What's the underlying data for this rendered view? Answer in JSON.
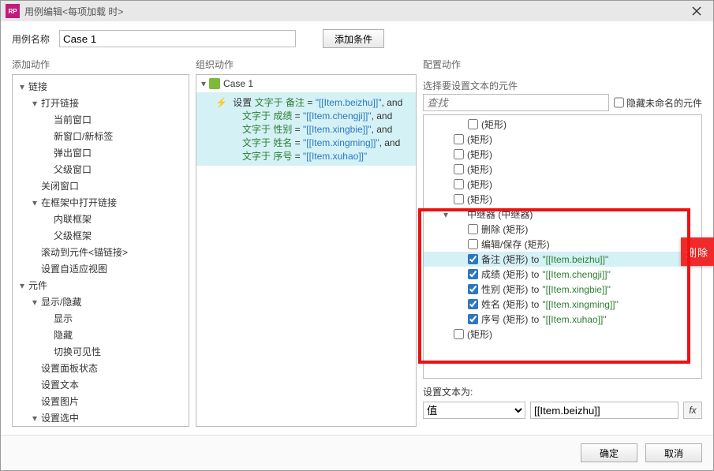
{
  "window": {
    "app_icon": "RP",
    "title": "用例编辑<每项加载 时>"
  },
  "name_row": {
    "label": "用例名称",
    "value": "Case 1",
    "add_condition": "添加条件"
  },
  "columns": {
    "left_header": "添加动作",
    "mid_header": "组织动作",
    "right_header": "配置动作"
  },
  "left_tree": [
    {
      "label": "链接",
      "indent": 0,
      "tw": "▾"
    },
    {
      "label": "打开链接",
      "indent": 1,
      "tw": "▾"
    },
    {
      "label": "当前窗口",
      "indent": 2,
      "tw": ""
    },
    {
      "label": "新窗口/新标签",
      "indent": 2,
      "tw": ""
    },
    {
      "label": "弹出窗口",
      "indent": 2,
      "tw": ""
    },
    {
      "label": "父级窗口",
      "indent": 2,
      "tw": ""
    },
    {
      "label": "关闭窗口",
      "indent": 1,
      "tw": ""
    },
    {
      "label": "在框架中打开链接",
      "indent": 1,
      "tw": "▾"
    },
    {
      "label": "内联框架",
      "indent": 2,
      "tw": ""
    },
    {
      "label": "父级框架",
      "indent": 2,
      "tw": ""
    },
    {
      "label": "滚动到元件<锚链接>",
      "indent": 1,
      "tw": ""
    },
    {
      "label": "设置自适应视图",
      "indent": 1,
      "tw": ""
    },
    {
      "label": "元件",
      "indent": 0,
      "tw": "▾"
    },
    {
      "label": "显示/隐藏",
      "indent": 1,
      "tw": "▾"
    },
    {
      "label": "显示",
      "indent": 2,
      "tw": ""
    },
    {
      "label": "隐藏",
      "indent": 2,
      "tw": ""
    },
    {
      "label": "切换可见性",
      "indent": 2,
      "tw": ""
    },
    {
      "label": "设置面板状态",
      "indent": 1,
      "tw": ""
    },
    {
      "label": "设置文本",
      "indent": 1,
      "tw": ""
    },
    {
      "label": "设置图片",
      "indent": 1,
      "tw": ""
    },
    {
      "label": "设置选中",
      "indent": 1,
      "tw": "▾"
    }
  ],
  "organize": {
    "case_label": "Case 1",
    "set_prefix": "设置",
    "lines": [
      {
        "field": "文字于 备注",
        "expr": "\"[[Item.beizhu]]\"",
        "tail": ", and"
      },
      {
        "field": "文字于 成绩",
        "expr": "\"[[Item.chengji]]\"",
        "tail": ", and"
      },
      {
        "field": "文字于 性别",
        "expr": "\"[[Item.xingbie]]\"",
        "tail": ", and"
      },
      {
        "field": "文字于 姓名",
        "expr": "\"[[Item.xingming]]\"",
        "tail": ", and"
      },
      {
        "field": "文字于 序号",
        "expr": "\"[[Item.xuhao]]\"",
        "tail": ""
      }
    ]
  },
  "right": {
    "select_widgets_title": "选择要设置文本的元件",
    "search_placeholder": "查找",
    "hide_unnamed_label": "隐藏未命名的元件",
    "tree": [
      {
        "indent": 1,
        "checked": false,
        "name": "(矩形)",
        "tw": ""
      },
      {
        "indent": 0,
        "checked": false,
        "name": "(矩形)",
        "tw": ""
      },
      {
        "indent": 0,
        "checked": false,
        "name": "(矩形)",
        "tw": ""
      },
      {
        "indent": 0,
        "checked": false,
        "name": "(矩形)",
        "tw": ""
      },
      {
        "indent": 0,
        "checked": false,
        "name": "(矩形)",
        "tw": ""
      },
      {
        "indent": 0,
        "checked": false,
        "name": "(矩形)",
        "tw": ""
      },
      {
        "indent": 0,
        "checked": null,
        "name": "中继器 (中继器)",
        "tw": "▾",
        "container": true
      },
      {
        "indent": 1,
        "checked": false,
        "name": "删除 (矩形)",
        "tw": ""
      },
      {
        "indent": 1,
        "checked": false,
        "name": "编辑/保存 (矩形)",
        "tw": ""
      },
      {
        "indent": 1,
        "checked": true,
        "name": "备注 (矩形)",
        "to": "to",
        "val": "\"[[Item.beizhu]]\"",
        "selected": true
      },
      {
        "indent": 1,
        "checked": true,
        "name": "成绩 (矩形)",
        "to": "to",
        "val": "\"[[Item.chengji]]\""
      },
      {
        "indent": 1,
        "checked": true,
        "name": "性别 (矩形)",
        "to": "to",
        "val": "\"[[Item.xingbie]]\""
      },
      {
        "indent": 1,
        "checked": true,
        "name": "姓名 (矩形)",
        "to": "to",
        "val": "\"[[Item.xingming]]\""
      },
      {
        "indent": 1,
        "checked": true,
        "name": "序号 (矩形)",
        "to": "to",
        "val": "\"[[Item.xuhao]]\""
      },
      {
        "indent": 0,
        "checked": false,
        "name": "(矩形)",
        "tw": ""
      }
    ],
    "set_value_label": "设置文本为:",
    "dropdown_value": "值",
    "text_value": "[[Item.beizhu]]"
  },
  "footer": {
    "ok": "确定",
    "cancel": "取消"
  },
  "side_tag": "删除"
}
